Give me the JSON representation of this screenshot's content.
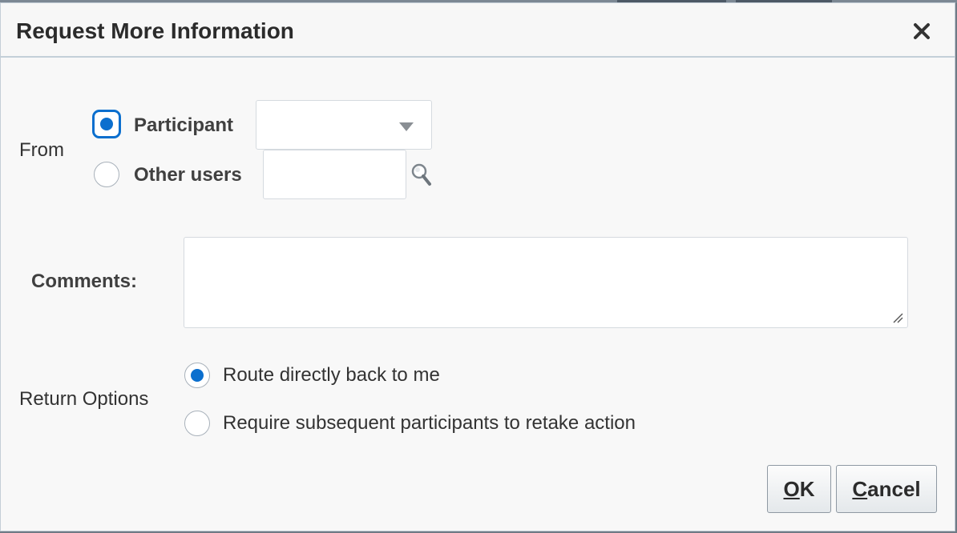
{
  "dialog": {
    "title": "Request More Information",
    "close_icon": "close-icon"
  },
  "from": {
    "label": "From",
    "options": [
      {
        "label": "Participant",
        "checked": true
      },
      {
        "label": "Other users",
        "checked": false
      }
    ],
    "participant_select_value": "",
    "other_users_value": "",
    "search_icon": "search-icon",
    "dropdown_icon": "chevron-down-icon"
  },
  "comments": {
    "label": "Comments:",
    "value": ""
  },
  "return_options": {
    "label": "Return Options",
    "options": [
      {
        "label": "Route directly back to me",
        "checked": true
      },
      {
        "label": "Require subsequent participants to retake action",
        "checked": false
      }
    ]
  },
  "buttons": {
    "ok_label": "OK",
    "ok_mnemonic": "O",
    "ok_rest": "K",
    "cancel_label": "Cancel",
    "cancel_mnemonic": "C",
    "cancel_rest": "ancel"
  },
  "colors": {
    "accent": "#0b6fce",
    "background": "#f8f8f8",
    "border": "#c4ced7"
  }
}
